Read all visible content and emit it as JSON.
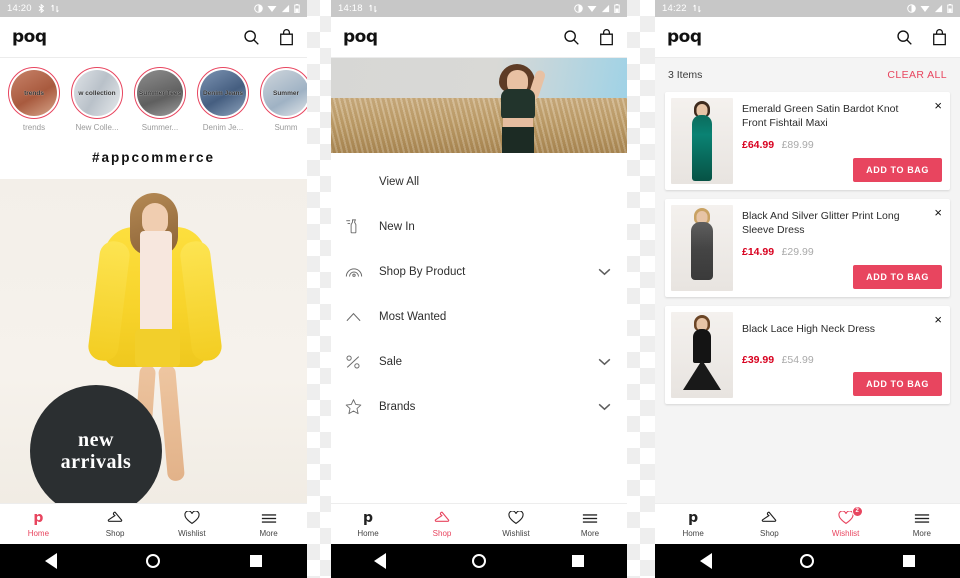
{
  "panels": [
    {
      "name": "home",
      "status": {
        "time": "14:20",
        "icons": [
          "bluetooth-icon",
          "sync-icon",
          "do-not-disturb-icon",
          "wifi-icon",
          "signal-icon",
          "battery-icon"
        ]
      },
      "appbar": {
        "logo": "poq",
        "search_icon": "search-icon",
        "bag_icon": "shopping-bag-icon"
      },
      "stories": [
        {
          "caption": "trends",
          "label": "trends"
        },
        {
          "caption": "w collection",
          "label": "New Colle..."
        },
        {
          "caption": "Summer Tees",
          "label": "Summer..."
        },
        {
          "caption": "Denim Jeans",
          "label": "Denim Je..."
        },
        {
          "caption": "Summer",
          "label": "Summ"
        }
      ],
      "hashtag": "#appcommerce",
      "hero": {
        "line1": "new",
        "line2": "arrivals"
      },
      "nav": [
        {
          "label": "Home",
          "icon": "poq-logo-icon",
          "active": true,
          "badge": ""
        },
        {
          "label": "Shop",
          "icon": "hanger-icon",
          "active": false,
          "badge": ""
        },
        {
          "label": "Wishlist",
          "icon": "heart-icon",
          "active": false,
          "badge": ""
        },
        {
          "label": "More",
          "icon": "hamburger-icon",
          "active": false,
          "badge": ""
        }
      ]
    },
    {
      "name": "shop",
      "status": {
        "time": "14:18"
      },
      "appbar": {
        "logo": "poq"
      },
      "menu": [
        {
          "label": "View All",
          "icon": "",
          "chevron": false
        },
        {
          "label": "New In",
          "icon": "dress-icon",
          "chevron": false
        },
        {
          "label": "Shop By Product",
          "icon": "rainbow-icon",
          "chevron": true
        },
        {
          "label": "Most Wanted",
          "icon": "caret-up-icon",
          "chevron": false
        },
        {
          "label": "Sale",
          "icon": "percent-icon",
          "chevron": true
        },
        {
          "label": "Brands",
          "icon": "star-icon",
          "chevron": true
        }
      ],
      "nav": [
        {
          "label": "Home",
          "icon": "poq-logo-icon",
          "active": false,
          "badge": ""
        },
        {
          "label": "Shop",
          "icon": "hanger-icon",
          "active": true,
          "badge": ""
        },
        {
          "label": "Wishlist",
          "icon": "heart-icon",
          "active": false,
          "badge": ""
        },
        {
          "label": "More",
          "icon": "hamburger-icon",
          "active": false,
          "badge": ""
        }
      ]
    },
    {
      "name": "wishlist",
      "status": {
        "time": "14:22"
      },
      "appbar": {
        "logo": "poq"
      },
      "header": {
        "count": "3 Items",
        "clear": "CLEAR ALL"
      },
      "items": [
        {
          "title": "Emerald Green Satin Bardot Knot Front Fishtail Maxi",
          "price_now": "£64.99",
          "price_was": "£89.99",
          "button": "ADD TO BAG",
          "remove": "×"
        },
        {
          "title": "Black And Silver Glitter Print Long Sleeve Dress",
          "price_now": "£14.99",
          "price_was": "£29.99",
          "button": "ADD TO BAG",
          "remove": "×"
        },
        {
          "title": "Black Lace High Neck Dress",
          "price_now": "£39.99",
          "price_was": "£54.99",
          "button": "ADD TO BAG",
          "remove": "×"
        }
      ],
      "nav": [
        {
          "label": "Home",
          "icon": "poq-logo-icon",
          "active": false,
          "badge": ""
        },
        {
          "label": "Shop",
          "icon": "hanger-icon",
          "active": false,
          "badge": ""
        },
        {
          "label": "Wishlist",
          "icon": "heart-icon",
          "active": true,
          "badge": "2"
        },
        {
          "label": "More",
          "icon": "hamburger-icon",
          "active": false,
          "badge": ""
        }
      ]
    }
  ],
  "colors": {
    "accent": "#e8455f",
    "price_red": "#d8011f",
    "status_bar": "#c7c7c7"
  },
  "system_nav": {
    "back": "back-triangle",
    "home": "home-circle",
    "recent": "recent-square"
  }
}
